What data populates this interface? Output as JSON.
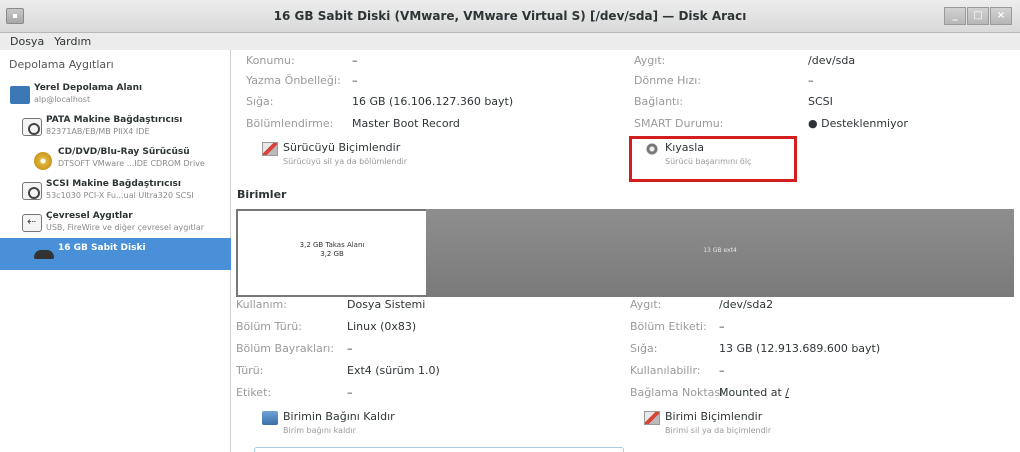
{
  "window": {
    "title": "16 GB Sabit Diski (VMware, VMware Virtual S) [/dev/sda] — Disk Aracı"
  },
  "menu": {
    "file": "Dosya",
    "help": "Yardım"
  },
  "sidebar": {
    "heading": "Depolama Aygıtları",
    "items": [
      {
        "title": "Yerel Depolama Alanı",
        "subtitle": "alp@localhost",
        "icon": "computer-icon"
      },
      {
        "title": "PATA Makine Bağdaştırıcısı",
        "subtitle": "82371AB/EB/MB PIIX4 IDE",
        "icon": "controller-icon"
      },
      {
        "title": "CD/DVD/Blu-Ray Sürücüsü",
        "subtitle": "DTSOFT VMware ...IDE CDROM Drive",
        "icon": "optical-disc-icon"
      },
      {
        "title": "SCSI Makine Bağdaştırıcısı",
        "subtitle": "53c1030 PCI-X Fu...ual Ultra320 SCSI",
        "icon": "controller-icon"
      },
      {
        "title": "Çevresel Aygıtlar",
        "subtitle": "USB, FireWire ve diğer çevresel aygıtlar",
        "icon": "usb-icon"
      },
      {
        "title": "16 GB Sabit Diski",
        "subtitle": "",
        "icon": "hard-disk-icon",
        "selected": true
      }
    ]
  },
  "drive": {
    "location_label": "Konumu:",
    "location_value": "–",
    "write_cache_label": "Yazma Önbelleği:",
    "write_cache_value": "–",
    "capacity_label": "Sığa:",
    "capacity_value": "16 GB (16.106.127.360 bayt)",
    "partitioning_label": "Bölümlendirme:",
    "partitioning_value": "Master Boot Record",
    "device_label": "Aygıt:",
    "device_value": "/dev/sda",
    "rotation_label": "Dönme Hızı:",
    "rotation_value": "–",
    "connection_label": "Bağlantı:",
    "connection_value": "SCSI",
    "smart_label": "SMART Durumu:",
    "smart_value": "Desteklenmiyor",
    "format_action": {
      "title": "Sürücüyü Biçimlendir",
      "subtitle": "Sürücüyü sil ya da bölümlendir"
    },
    "benchmark_action": {
      "title": "Kıyasla",
      "subtitle": "Sürücü başarımını ölç"
    }
  },
  "volumes": {
    "heading": "Birimler",
    "swap": {
      "line1": "3,2 GB Takas Alanı",
      "line2": "3,2 GB"
    },
    "ext4": {
      "label": "13 GB ext4"
    }
  },
  "volume": {
    "usage_label": "Kullanım:",
    "usage_value": "Dosya Sistemi",
    "partition_type_label": "Bölüm Türü:",
    "partition_type_value": "Linux (0x83)",
    "partition_flags_label": "Bölüm Bayrakları:",
    "partition_flags_value": "–",
    "type_label": "Türü:",
    "type_value": "Ext4 (sürüm 1.0)",
    "tag_label": "Etiket:",
    "tag_value": "–",
    "device_label": "Aygıt:",
    "device_value": "/dev/sda2",
    "partition_label_label": "Bölüm Etiketi:",
    "partition_label_value": "–",
    "capacity_label": "Sığa:",
    "capacity_value": "13 GB (12.913.689.600 bayt)",
    "available_label": "Kullanılabilir:",
    "available_value": "–",
    "mount_label": "Bağlama Noktası:",
    "mount_value": "Mounted at",
    "mount_link": "/",
    "unmount_action": {
      "title": "Birimin Bağını Kaldır",
      "subtitle": "Birim bağını kaldır"
    },
    "format_action": {
      "title": "Birimi Biçimlendir",
      "subtitle": "Birimi sil ya da biçimlendir"
    }
  },
  "colors": {
    "selection": "#4a90d9",
    "highlight": "#d21e1e"
  }
}
